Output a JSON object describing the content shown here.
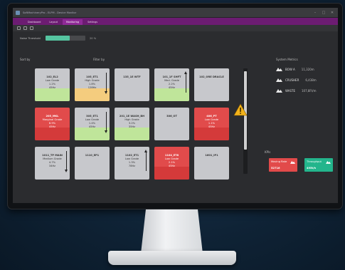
{
  "window": {
    "title": "SoftMachineryPro - ELPM - Device Monitor"
  },
  "tabs": [
    {
      "label": "Dashboard",
      "active": false
    },
    {
      "label": "Layout",
      "active": false
    },
    {
      "label": "Monitoring",
      "active": true
    },
    {
      "label": "Settings",
      "active": false
    }
  ],
  "filter": {
    "label": "Noise Threshold",
    "value_text": "20 %",
    "value_fraction": 0.6
  },
  "sections": {
    "left": "Sort by",
    "middle": "Filter by",
    "right": "System Metrics",
    "bottom_right": "KPIs"
  },
  "tiles": [
    {
      "name": "102_EL2",
      "l2": "Low Grade",
      "l3": "1.2%",
      "l4": "45Hz",
      "color": "green",
      "arrow": "none"
    },
    {
      "name": "105_ET1",
      "l2": "High Grade",
      "l3": "1.8%",
      "l4": "128Hz",
      "color": "orange",
      "arrow": "down"
    },
    {
      "name": "135_1E WTF",
      "l2": "",
      "l3": "",
      "l4": "",
      "color": "gray",
      "arrow": "none"
    },
    {
      "name": "101_1F SHFT",
      "l2": "Med. Grade",
      "l3": "2.2%",
      "l4": "45Hz",
      "color": "green",
      "arrow": "up"
    },
    {
      "name": "102_ORE DRACLE",
      "l2": "",
      "l3": "",
      "l4": "",
      "color": "gray",
      "arrow": "none"
    },
    {
      "name": "205_MKL",
      "l2": "Marginal Grade",
      "l3": "8.9%",
      "l4": "45Hz",
      "color": "red",
      "arrow": "none"
    },
    {
      "name": "305_ET1",
      "l2": "Low Grade",
      "l3": "1.4%",
      "l4": "45Hz",
      "color": "green",
      "arrow": "down"
    },
    {
      "name": "201_1E WASH_BH",
      "l2": "High Grade",
      "l3": "3.2%",
      "l4": "35Hz",
      "color": "green",
      "arrow": "none"
    },
    {
      "name": "306_OT",
      "l2": "",
      "l3": "",
      "l4": "",
      "color": "gray",
      "arrow": "none"
    },
    {
      "name": "406_PT",
      "l2": "Low Grade",
      "l3": "1.1%",
      "l4": "45Hz",
      "color": "red",
      "arrow": "none"
    },
    {
      "name": "1011_TP MAIN",
      "l2": "Medium Grade",
      "l3": "4.7%",
      "l4": "34Hz",
      "color": "gray",
      "arrow": "down"
    },
    {
      "name": "1110_EP1",
      "l2": "",
      "l3": "",
      "l4": "",
      "color": "gray",
      "arrow": "none"
    },
    {
      "name": "1102_ET1",
      "l2": "Low Grade",
      "l3": "1.3%",
      "l4": "78Hz",
      "color": "gray",
      "arrow": "up"
    },
    {
      "name": "1104_ET8",
      "l2": "Low Grade",
      "l3": "2.1%",
      "l4": "45Hz",
      "color": "red",
      "arrow": "none"
    },
    {
      "name": "1601_IP1",
      "l2": "",
      "l3": "",
      "l4": "",
      "color": "gray",
      "arrow": "none"
    }
  ],
  "metrics": [
    {
      "label": "BOW A",
      "value": "11,320m"
    },
    {
      "label": "CRUSHER",
      "value": "6,438m"
    },
    {
      "label": "WASTE",
      "value": "107,8Ft/m"
    }
  ],
  "kpis": [
    {
      "label": "Moving Rate",
      "value": "52716",
      "color": "#e24a4a"
    },
    {
      "label": "Throughput",
      "value": "495t/h",
      "color": "#23b58c"
    }
  ],
  "colors": {
    "tab_bar": "#6c1c72",
    "accent_green": "#55c4a0",
    "alert_red": "#e14b4b",
    "warning": "#f2b31b"
  }
}
